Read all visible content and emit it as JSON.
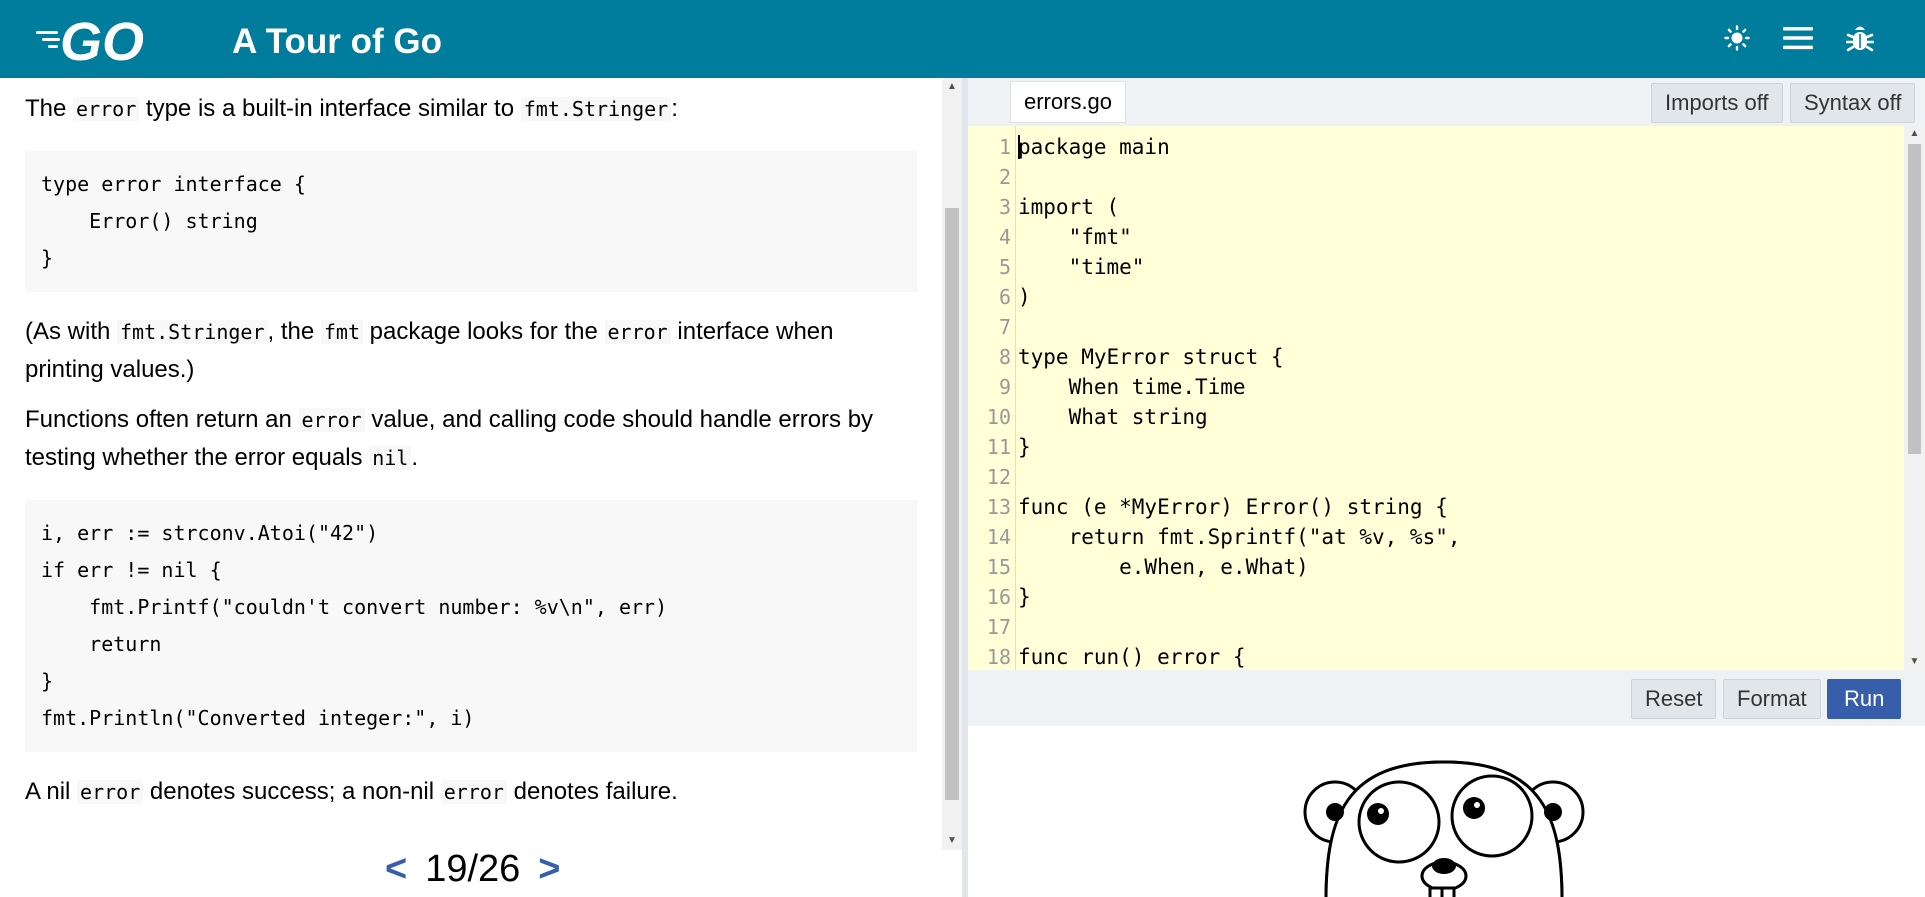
{
  "header": {
    "title": "A Tour of Go",
    "logo_text": "GO",
    "icons": [
      "sun-icon",
      "menu-icon",
      "bug-icon"
    ],
    "bg_color": "#007d9c"
  },
  "lesson": {
    "p1": {
      "t1": "The ",
      "c1": "error",
      "t2": " type is a built-in interface similar to ",
      "c2": "fmt.Stringer",
      "t3": ":"
    },
    "code1": "type error interface {\n    Error() string\n}",
    "p2": {
      "t1": "(As with ",
      "c1": "fmt.Stringer",
      "t2": ", the ",
      "c2": "fmt",
      "t3": " package looks for the ",
      "c3": "error",
      "t4": " interface when printing values.)"
    },
    "p3": {
      "t1": "Functions often return an ",
      "c1": "error",
      "t2": " value, and calling code should handle errors by testing whether the error equals ",
      "c2": "nil",
      "t3": "."
    },
    "code2": "i, err := strconv.Atoi(\"42\")\nif err != nil {\n    fmt.Printf(\"couldn't convert number: %v\\n\", err)\n    return\n}\nfmt.Println(\"Converted integer:\", i)",
    "p4": {
      "t1": "A nil ",
      "c1": "error",
      "t2": " denotes success; a non-nil ",
      "c2": "error",
      "t3": " denotes failure."
    }
  },
  "pager": {
    "prev": "<",
    "page": "19/26",
    "next": ">"
  },
  "editor": {
    "filename": "errors.go",
    "imports_label": "Imports off",
    "syntax_label": "Syntax off",
    "lines": [
      "package main",
      "",
      "import (",
      "    \"fmt\"",
      "    \"time\"",
      ")",
      "",
      "type MyError struct {",
      "    When time.Time",
      "    What string",
      "}",
      "",
      "func (e *MyError) Error() string {",
      "    return fmt.Sprintf(\"at %v, %s\",",
      "        e.When, e.What)",
      "}",
      "",
      "func run() error {"
    ],
    "bg_color": "#ffffd8"
  },
  "controls": {
    "reset_label": "Reset",
    "format_label": "Format",
    "run_label": "Run",
    "run_color": "#375eab"
  }
}
